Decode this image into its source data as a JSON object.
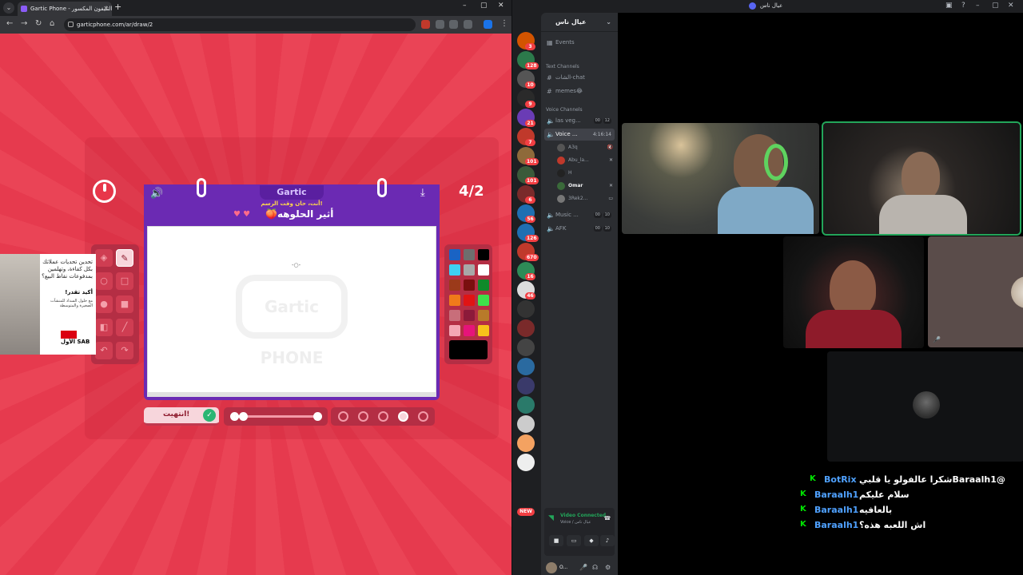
{
  "browser": {
    "tab_title": "Gartic Phone - لعبة التليفون المكسور",
    "url": "garticphone.com/ar/draw/2",
    "new_tab": "+",
    "window_controls": [
      "–",
      "▢",
      "✕"
    ]
  },
  "game": {
    "logo_text": "Gartic",
    "counter": "4/2",
    "subtitle": "أنت، حان وقت الرسم!",
    "prompt": "أثير الحلوهه🍑",
    "canvas_watermark": "Gartic PHONE",
    "done_label": "انتهيت!",
    "brush_size_fraction": 0.1,
    "selected_opacity_index": 3,
    "palette_colors": [
      "#1a63c4",
      "#6e6e6e",
      "#000000",
      "#3fd0f2",
      "#a8a8a8",
      "#ffffff",
      "#9b3a1a",
      "#7a0f0f",
      "#0f8a2a",
      "#f07b1a",
      "#e01414",
      "#3ee04a",
      "#c86e7a",
      "#8c1a3a",
      "#b87a2a",
      "#f4a6b4",
      "#e6147a",
      "#f7c21a"
    ],
    "current_color": "#000000"
  },
  "ad": {
    "headline": "تحدين تحديات عملاتك بكل كفاءة، وتهلمين بمدفوعات نقاط البيع؟",
    "cta": "أكيد تقدر!",
    "small": "مع حلول السداد للمنشآت الصغيرة والمتوسطة",
    "brand": "الأول SAB"
  },
  "discord": {
    "window_title": "عيال ناس",
    "server_name": "عيال ناس",
    "events_label": "Events",
    "text_category": "Text Channels",
    "text_channels": [
      "الشات-chat",
      "memes😂"
    ],
    "voice_category": "Voice Channels",
    "voice_channels": [
      {
        "name": "las veg...",
        "a": "00",
        "b": "12"
      },
      {
        "name": "Voice ...",
        "time": "4:16:14"
      },
      {
        "name": "Music ...",
        "a": "00",
        "b": "10"
      },
      {
        "name": "AFK",
        "a": "00",
        "b": "10"
      }
    ],
    "voice_users": [
      "A3q",
      "Abu_la...",
      "H",
      "Omar",
      "3Rek2..."
    ],
    "guild_badges": [
      "3",
      "128",
      "10",
      "9",
      "21",
      "7",
      "101",
      "101",
      "6",
      "56",
      "126",
      "670",
      "16",
      "46"
    ],
    "new_label": "NEW",
    "vc_status": "Video Connected",
    "vc_sub": "Voice / عيال ناس",
    "username": "O...",
    "chat": [
      {
        "user": "BotRix",
        "text": "@Baraalh1شكرا عالفولو يا قلبي"
      },
      {
        "user": "Baraalh1",
        "text": "سلام عليكم"
      },
      {
        "user": "Baraalh1",
        "text": "بالعافيه"
      },
      {
        "user": "Baraalh1",
        "text": "اش اللعبه هذه؟"
      }
    ]
  }
}
